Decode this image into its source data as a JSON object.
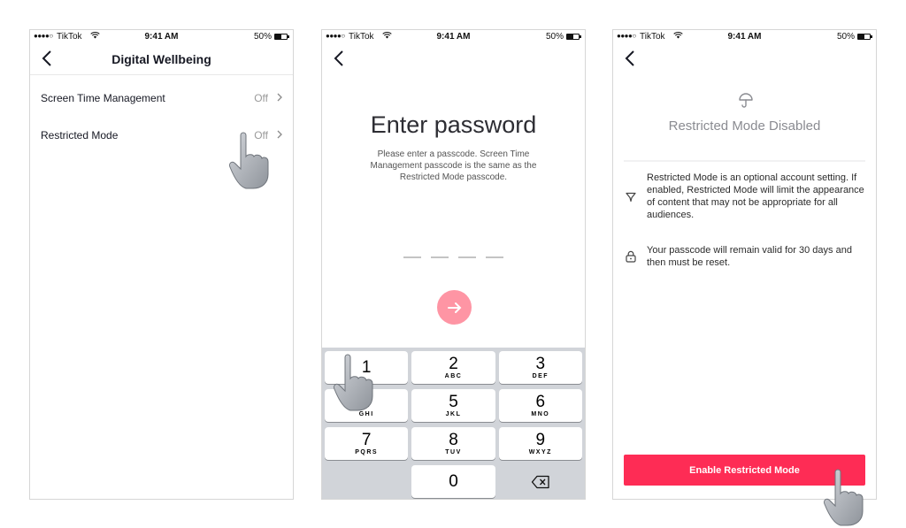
{
  "status_bar": {
    "signal": "●●●●○",
    "carrier": "TikTok",
    "time": "9:41 AM",
    "battery": "50%"
  },
  "screen1": {
    "title": "Digital Wellbeing",
    "settings": [
      {
        "label": "Screen Time Management",
        "value": "Off"
      },
      {
        "label": "Restricted Mode",
        "value": "Off"
      }
    ]
  },
  "screen2": {
    "title": "Enter password",
    "description": "Please enter a passcode. Screen Time Management passcode is the same as the Restricted Mode passcode.",
    "passcode_length": 4,
    "keypad": [
      {
        "num": "1",
        "letters": ""
      },
      {
        "num": "2",
        "letters": "ABC"
      },
      {
        "num": "3",
        "letters": "DEF"
      },
      {
        "num": "4",
        "letters": "GHI"
      },
      {
        "num": "5",
        "letters": "JKL"
      },
      {
        "num": "6",
        "letters": "MNO"
      },
      {
        "num": "7",
        "letters": "PQRS"
      },
      {
        "num": "8",
        "letters": "TUV"
      },
      {
        "num": "9",
        "letters": "WXYZ"
      },
      {
        "num": "",
        "letters": ""
      },
      {
        "num": "0",
        "letters": ""
      },
      {
        "num": "⌫",
        "letters": ""
      }
    ]
  },
  "screen3": {
    "status_title": "Restricted Mode Disabled",
    "info": [
      {
        "icon": "filter-icon",
        "text": "Restricted Mode is an optional account setting. If enabled, Restricted Mode will limit the appearance of content that may not be appropriate for all audiences."
      },
      {
        "icon": "lock-icon",
        "text": "Your passcode will remain valid for 30 days and then must be reset."
      }
    ],
    "button_label": "Enable Restricted Mode"
  },
  "colors": {
    "accent": "#fe2c55",
    "submit_disabled": "#fe95a4",
    "keypad_bg": "#d1d4d9"
  }
}
